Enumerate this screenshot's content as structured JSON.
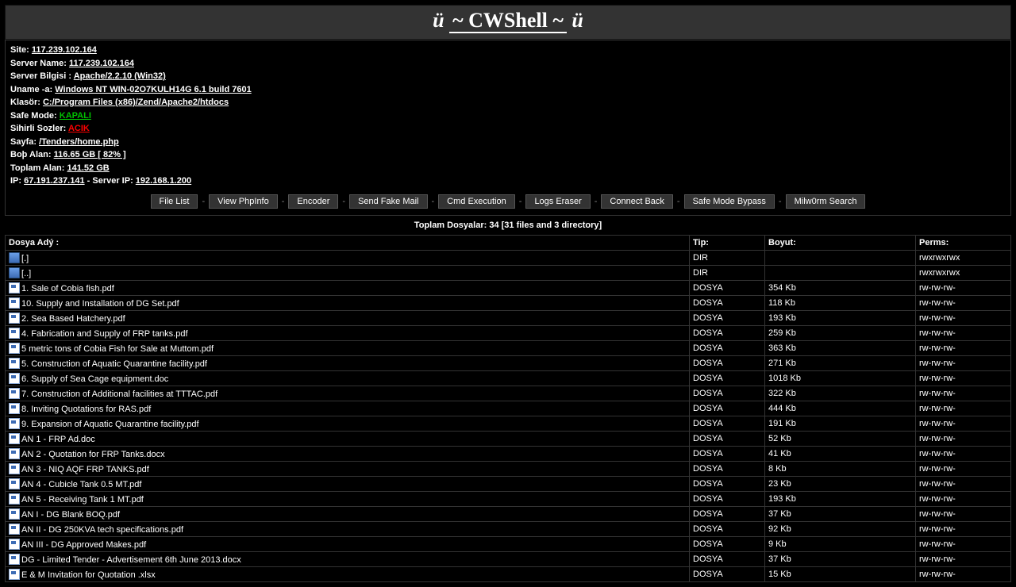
{
  "title": {
    "left_umlaut": "ü",
    "right_umlaut": "ü",
    "center": "~ CWShell ~"
  },
  "info": {
    "site_label": "Site:",
    "site": "117.239.102.164",
    "server_name_label": "Server Name:",
    "server_name": "117.239.102.164",
    "server_software_label": "Server Bilgisi :",
    "server_software": "Apache/2.2.10 (Win32)",
    "uname_label": "Uname -a:",
    "uname": "Windows NT WIN-02O7KULH14G 6.1 build 7601",
    "folder_label": "Klasör:",
    "folder": "C:/Program Files (x86)/Zend/Apache2/htdocs",
    "safe_mode_label": "Safe Mode:",
    "safe_mode": "KAPALI",
    "magic_quotes_label": "Sihirli Sozler:",
    "magic_quotes": "ACIK",
    "page_label": "Sayfa:",
    "page": "/Tenders/home.php",
    "free_space_label": "Boþ Alan:",
    "free_space": "116.65 GB [ 82% ]",
    "total_space_label": "Toplam Alan:",
    "total_space": "141.52 GB",
    "ip_label": "IP:",
    "ip": "67.191.237.141",
    "server_ip_sep": " - Server IP: ",
    "server_ip": "192.168.1.200"
  },
  "nav": [
    "File List",
    "View PhpInfo",
    "Encoder",
    "Send Fake Mail",
    "Cmd Execution",
    "Logs Eraser",
    "Connect Back",
    "Safe Mode Bypass",
    "Milw0rm Search"
  ],
  "totals": "Toplam Dosyalar: 34 [31 files and 3 directory]",
  "columns": {
    "name": "Dosya Adý :",
    "type": "Tip:",
    "size": "Boyut:",
    "perms": "Perms:"
  },
  "rows": [
    {
      "icon": "folder",
      "name": "[.]",
      "type": "DIR",
      "size": "",
      "perms": "rwxrwxrwx"
    },
    {
      "icon": "folder",
      "name": "[..]",
      "type": "DIR",
      "size": "",
      "perms": "rwxrwxrwx"
    },
    {
      "icon": "file",
      "name": "1. Sale of Cobia fish.pdf",
      "type": "DOSYA",
      "size": "354 Kb",
      "perms": "rw-rw-rw-"
    },
    {
      "icon": "file",
      "name": "10. Supply and Installation of DG Set.pdf",
      "type": "DOSYA",
      "size": "118 Kb",
      "perms": "rw-rw-rw-"
    },
    {
      "icon": "file",
      "name": "2. Sea Based Hatchery.pdf",
      "type": "DOSYA",
      "size": "193 Kb",
      "perms": "rw-rw-rw-"
    },
    {
      "icon": "file",
      "name": "4. Fabrication and Supply of FRP tanks.pdf",
      "type": "DOSYA",
      "size": "259 Kb",
      "perms": "rw-rw-rw-"
    },
    {
      "icon": "file",
      "name": "5 metric tons of Cobia Fish for Sale at Muttom.pdf",
      "type": "DOSYA",
      "size": "363 Kb",
      "perms": "rw-rw-rw-"
    },
    {
      "icon": "file",
      "name": "5. Construction of Aquatic Quarantine facility.pdf",
      "type": "DOSYA",
      "size": "271 Kb",
      "perms": "rw-rw-rw-"
    },
    {
      "icon": "file",
      "name": "6. Supply of Sea Cage equipment.doc",
      "type": "DOSYA",
      "size": "1018 Kb",
      "perms": "rw-rw-rw-"
    },
    {
      "icon": "file",
      "name": "7. Construction of Additional facilities at TTTAC.pdf",
      "type": "DOSYA",
      "size": "322 Kb",
      "perms": "rw-rw-rw-"
    },
    {
      "icon": "file",
      "name": "8. Inviting Quotations for RAS.pdf",
      "type": "DOSYA",
      "size": "444 Kb",
      "perms": "rw-rw-rw-"
    },
    {
      "icon": "file",
      "name": "9. Expansion of Aquatic Quarantine facility.pdf",
      "type": "DOSYA",
      "size": "191 Kb",
      "perms": "rw-rw-rw-"
    },
    {
      "icon": "file",
      "name": "AN 1 - FRP Ad.doc",
      "type": "DOSYA",
      "size": "52 Kb",
      "perms": "rw-rw-rw-"
    },
    {
      "icon": "file",
      "name": "AN 2 - Quotation for FRP Tanks.docx",
      "type": "DOSYA",
      "size": "41 Kb",
      "perms": "rw-rw-rw-"
    },
    {
      "icon": "file",
      "name": "AN 3 - NIQ AQF FRP TANKS.pdf",
      "type": "DOSYA",
      "size": "8 Kb",
      "perms": "rw-rw-rw-"
    },
    {
      "icon": "file",
      "name": "AN 4 - Cubicle Tank 0.5 MT.pdf",
      "type": "DOSYA",
      "size": "23 Kb",
      "perms": "rw-rw-rw-"
    },
    {
      "icon": "file",
      "name": "AN 5 - Receiving Tank 1 MT.pdf",
      "type": "DOSYA",
      "size": "193 Kb",
      "perms": "rw-rw-rw-"
    },
    {
      "icon": "file",
      "name": "AN I - DG Blank BOQ.pdf",
      "type": "DOSYA",
      "size": "37 Kb",
      "perms": "rw-rw-rw-"
    },
    {
      "icon": "file",
      "name": "AN II - DG 250KVA tech specifications.pdf",
      "type": "DOSYA",
      "size": "92 Kb",
      "perms": "rw-rw-rw-"
    },
    {
      "icon": "file",
      "name": "AN III - DG Approved Makes.pdf",
      "type": "DOSYA",
      "size": "9 Kb",
      "perms": "rw-rw-rw-"
    },
    {
      "icon": "file",
      "name": "DG - Limited Tender - Advertisement 6th June 2013.docx",
      "type": "DOSYA",
      "size": "37 Kb",
      "perms": "rw-rw-rw-"
    },
    {
      "icon": "file",
      "name": "E & M Invitation for Quotation .xlsx",
      "type": "DOSYA",
      "size": "15 Kb",
      "perms": "rw-rw-rw-"
    }
  ]
}
